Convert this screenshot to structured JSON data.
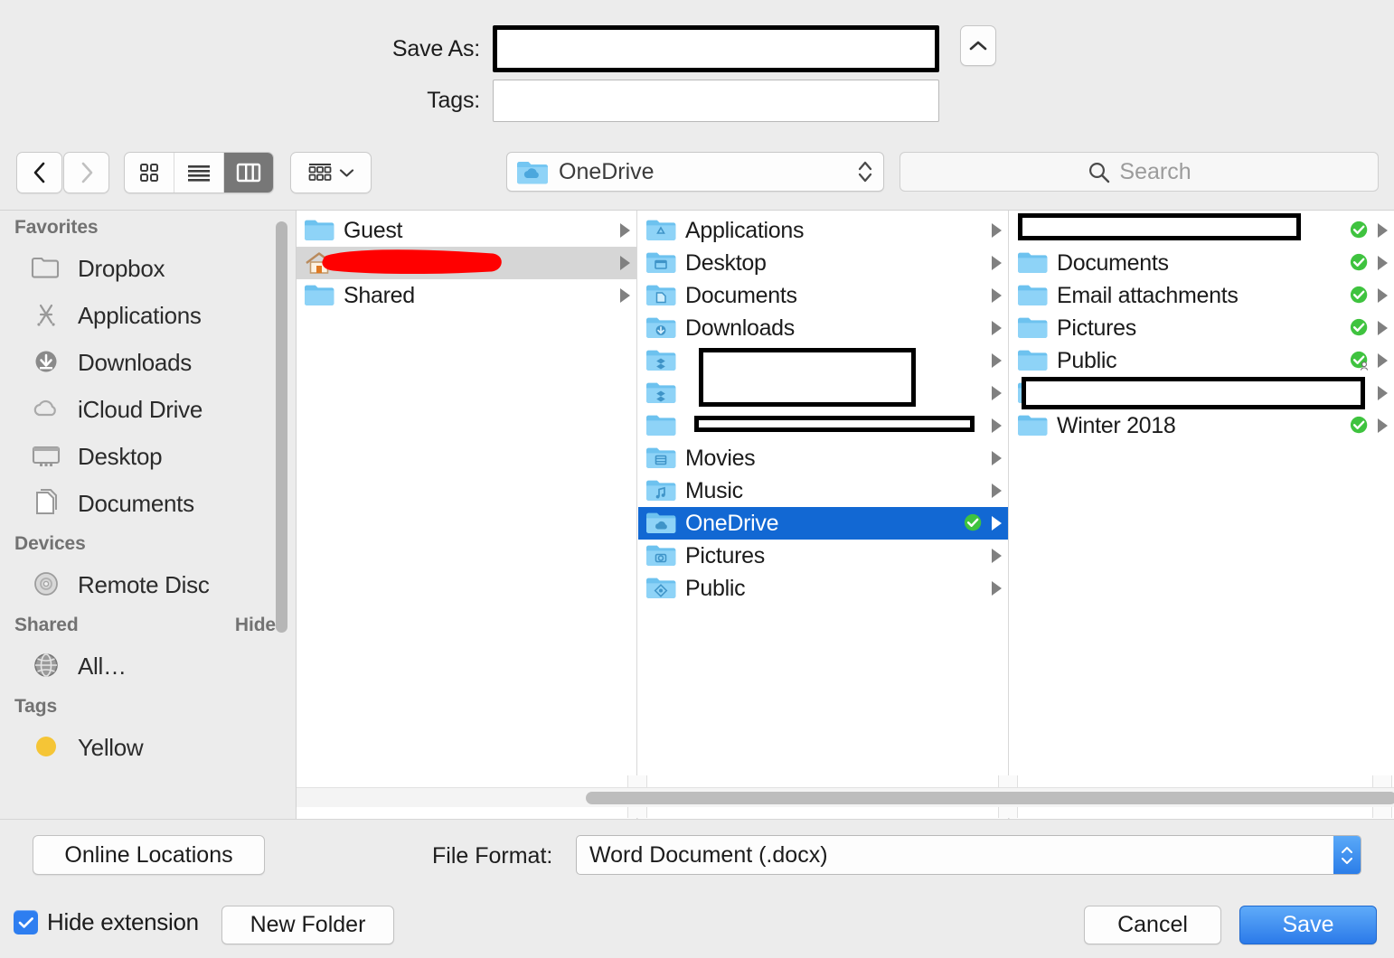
{
  "fields": {
    "save_as_label": "Save As:",
    "save_as_value": "",
    "tags_label": "Tags:",
    "tags_value": ""
  },
  "toolbar": {
    "back_icon": "chevron-left-icon",
    "forward_icon": "chevron-right-icon",
    "view_icon_label": "icon-view",
    "view_list_label": "list-view",
    "view_column_label": "column-view",
    "active_view": "column-view",
    "arrange_label": "arrange-by",
    "location_value": "OneDrive",
    "search_placeholder": "Search",
    "search_value": ""
  },
  "sidebar": {
    "sections": [
      {
        "title": "Favorites",
        "action": "",
        "items": [
          {
            "label": "Dropbox",
            "icon": "folder-icon"
          },
          {
            "label": "Applications",
            "icon": "applications-icon"
          },
          {
            "label": "Downloads",
            "icon": "downloads-icon"
          },
          {
            "label": "iCloud Drive",
            "icon": "cloud-icon"
          },
          {
            "label": "Desktop",
            "icon": "desktop-icon"
          },
          {
            "label": "Documents",
            "icon": "documents-icon"
          }
        ]
      },
      {
        "title": "Devices",
        "action": "",
        "items": [
          {
            "label": "Remote Disc",
            "icon": "disc-icon"
          }
        ]
      },
      {
        "title": "Shared",
        "action": "Hide",
        "items": [
          {
            "label": "All…",
            "icon": "network-globe-icon"
          }
        ]
      },
      {
        "title": "Tags",
        "action": "",
        "items": [
          {
            "label": "Yellow",
            "icon": "yellow-tag-icon"
          }
        ]
      }
    ]
  },
  "columns": [
    {
      "name": "column-1",
      "rows": [
        {
          "label": "Guest",
          "icon": "folder-blue-icon",
          "selected": false,
          "redacted": false,
          "sync": false,
          "shared": false
        },
        {
          "label": "",
          "icon": "home-icon",
          "selected": true,
          "redacted": "scribble",
          "sync": false,
          "shared": false
        },
        {
          "label": "Shared",
          "icon": "folder-blue-icon",
          "selected": false,
          "redacted": false,
          "sync": false,
          "shared": false
        }
      ]
    },
    {
      "name": "column-2",
      "rows": [
        {
          "label": "Applications",
          "icon": "folder-applications-icon",
          "selected": false,
          "redacted": false,
          "sync": false,
          "shared": false
        },
        {
          "label": "Desktop",
          "icon": "folder-desktop-icon",
          "selected": false,
          "redacted": false,
          "sync": false,
          "shared": false
        },
        {
          "label": "Documents",
          "icon": "folder-documents-icon",
          "selected": false,
          "redacted": false,
          "sync": false,
          "shared": false
        },
        {
          "label": "Downloads",
          "icon": "folder-downloads-icon",
          "selected": false,
          "redacted": false,
          "sync": false,
          "shared": false
        },
        {
          "label": "",
          "icon": "folder-dropbox-icon",
          "selected": false,
          "redacted": "box",
          "sync": false,
          "shared": false
        },
        {
          "label": "",
          "icon": "folder-dropbox-icon",
          "selected": false,
          "redacted": "box",
          "sync": false,
          "shared": false
        },
        {
          "label": "",
          "icon": "folder-blue-icon",
          "selected": false,
          "redacted": "bar",
          "sync": false,
          "shared": false
        },
        {
          "label": "Movies",
          "icon": "folder-movies-icon",
          "selected": false,
          "redacted": false,
          "sync": false,
          "shared": false
        },
        {
          "label": "Music",
          "icon": "folder-music-icon",
          "selected": false,
          "redacted": false,
          "sync": false,
          "shared": false
        },
        {
          "label": "OneDrive",
          "icon": "folder-onedrive-icon",
          "selected": true,
          "redacted": false,
          "sync": true,
          "shared": false
        },
        {
          "label": "Pictures",
          "icon": "folder-pictures-icon",
          "selected": false,
          "redacted": false,
          "sync": false,
          "shared": false
        },
        {
          "label": "Public",
          "icon": "folder-public-icon",
          "selected": false,
          "redacted": false,
          "sync": false,
          "shared": false
        }
      ]
    },
    {
      "name": "column-3",
      "rows": [
        {
          "label": "",
          "icon": "folder-blue-icon",
          "selected": false,
          "redacted": "box",
          "sync": true,
          "shared": false
        },
        {
          "label": "Documents",
          "icon": "folder-blue-icon",
          "selected": false,
          "redacted": false,
          "sync": true,
          "shared": false
        },
        {
          "label": "Email attachments",
          "icon": "folder-blue-icon",
          "selected": false,
          "redacted": false,
          "sync": true,
          "shared": false
        },
        {
          "label": "Pictures",
          "icon": "folder-blue-icon",
          "selected": false,
          "redacted": false,
          "sync": true,
          "shared": false
        },
        {
          "label": "Public",
          "icon": "folder-blue-icon",
          "selected": false,
          "redacted": false,
          "sync": true,
          "shared": true
        },
        {
          "label": "",
          "icon": "folder-blue-icon",
          "selected": false,
          "redacted": "box",
          "sync": false,
          "shared": false
        },
        {
          "label": "Winter 2018",
          "icon": "folder-blue-icon",
          "selected": false,
          "redacted": false,
          "sync": true,
          "shared": false
        }
      ]
    }
  ],
  "bottom": {
    "online_locations_label": "Online Locations",
    "file_format_label": "File Format:",
    "file_format_value": "Word Document (.docx)",
    "hide_extension_label": "Hide extension",
    "hide_extension_checked": true,
    "new_folder_label": "New Folder",
    "cancel_label": "Cancel",
    "save_label": "Save"
  },
  "colors": {
    "accent_blue": "#2b7ae9",
    "selection_blue": "#1268d3",
    "sync_green": "#3fc33f",
    "redaction_red": "#ff0000",
    "folder_blue": "#6cc4f5",
    "window_gray": "#ececec"
  }
}
